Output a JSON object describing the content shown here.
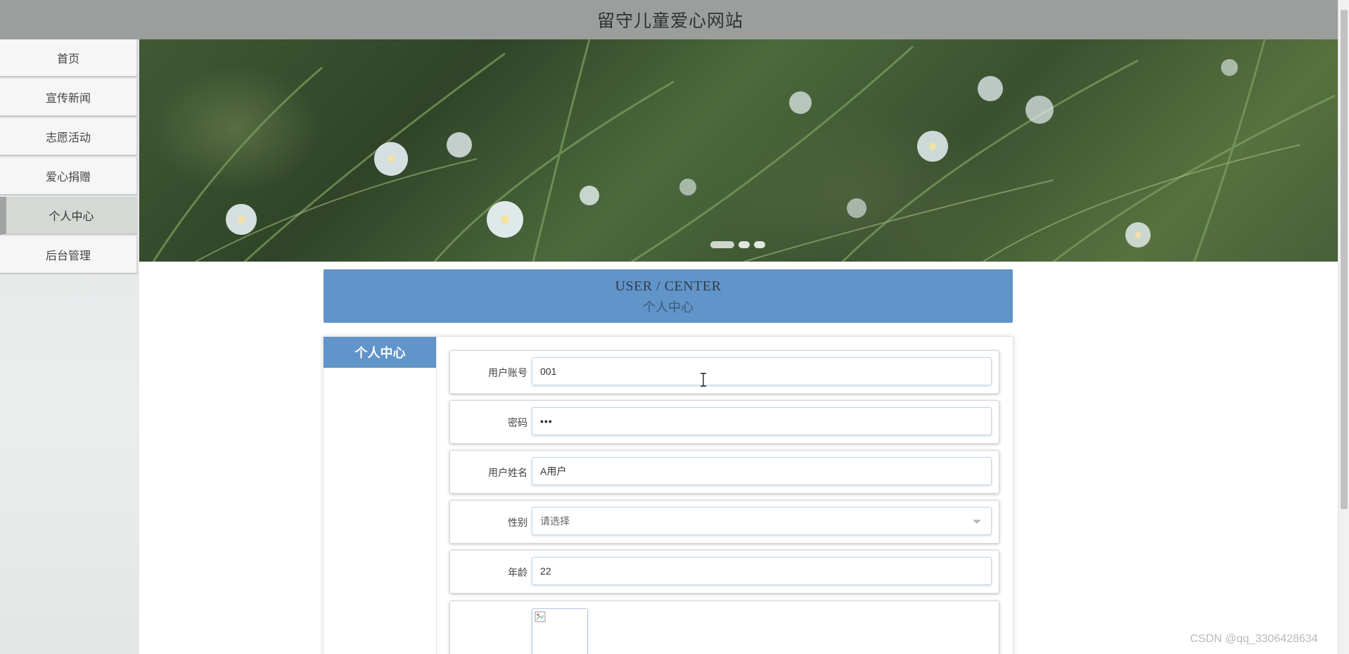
{
  "header": {
    "title": "留守儿童爱心网站"
  },
  "sidebar": {
    "items": [
      {
        "label": "首页"
      },
      {
        "label": "宣传新闻"
      },
      {
        "label": "志愿活动"
      },
      {
        "label": "爱心捐赠"
      },
      {
        "label": "个人中心",
        "active": true
      },
      {
        "label": "后台管理"
      }
    ]
  },
  "banner": {
    "slide_count": 3,
    "active_slide": 1
  },
  "section": {
    "title_en": "USER / CENTER",
    "title_zh": "个人中心"
  },
  "panel": {
    "tab_label": "个人中心",
    "form": {
      "username": {
        "label": "用户账号",
        "value": "001"
      },
      "password": {
        "label": "密码",
        "value": "•••"
      },
      "name": {
        "label": "用户姓名",
        "value": "A用户"
      },
      "gender": {
        "label": "性别",
        "value": "请选择"
      },
      "age": {
        "label": "年龄",
        "value": "22"
      }
    }
  },
  "watermark": "CSDN @qq_3306428634",
  "colors": {
    "accent": "#6194c8",
    "topbar": "#9a9e9c"
  }
}
